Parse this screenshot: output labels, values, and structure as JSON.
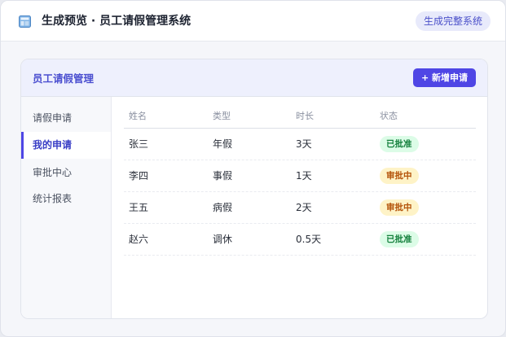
{
  "app": {
    "title": "生成预览 · 员工请假管理系统",
    "generate_button": "生成完整系统"
  },
  "card": {
    "title": "员工请假管理",
    "new_button": "+ 新增申请"
  },
  "sidebar": {
    "items": [
      {
        "label": "请假申请",
        "active": false
      },
      {
        "label": "我的申请",
        "active": true
      },
      {
        "label": "审批中心",
        "active": false
      },
      {
        "label": "统计报表",
        "active": false
      }
    ]
  },
  "table": {
    "columns": [
      "姓名",
      "类型",
      "时长",
      "状态"
    ],
    "rows": [
      {
        "name": "张三",
        "type": "年假",
        "duration": "3天",
        "status": "已批准",
        "status_kind": "approved"
      },
      {
        "name": "李四",
        "type": "事假",
        "duration": "1天",
        "status": "审批中",
        "status_kind": "pending"
      },
      {
        "name": "王五",
        "type": "病假",
        "duration": "2天",
        "status": "审批中",
        "status_kind": "pending"
      },
      {
        "name": "赵六",
        "type": "调休",
        "duration": "0.5天",
        "status": "已批准",
        "status_kind": "approved"
      }
    ]
  },
  "colors": {
    "accent": "#4f46e5",
    "approved_bg": "#dcfce7",
    "approved_text": "#15803d",
    "pending_bg": "#fef3c7",
    "pending_text": "#b45309"
  },
  "icons": {
    "app": "window-icon"
  }
}
